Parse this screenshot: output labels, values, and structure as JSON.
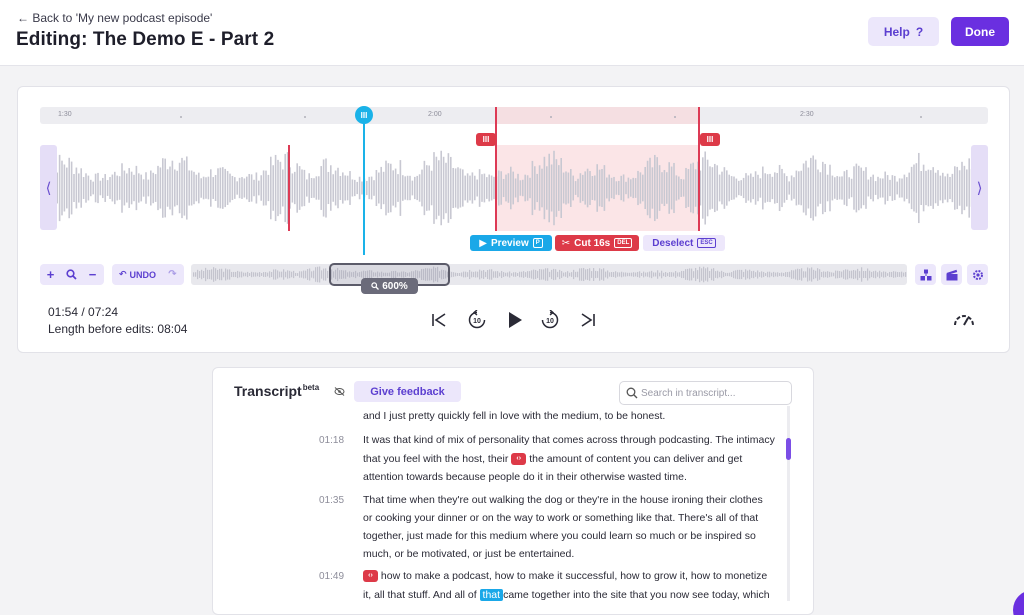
{
  "header": {
    "back_label": "← Back to 'My new podcast episode'",
    "title": "Editing: The Demo E - Part 2",
    "help_label": "Help",
    "help_icon": "?",
    "done_label": "Done"
  },
  "timeline": {
    "ticks": [
      "1:30",
      "2:00",
      "2:30"
    ]
  },
  "selection_actions": {
    "preview_label": "Preview",
    "preview_key": "P",
    "cut_label": "Cut 16s",
    "cut_key": "DEL",
    "deselect_label": "Deselect",
    "deselect_key": "ESC"
  },
  "toolbar": {
    "zoom_in": "+",
    "zoom_out": "−",
    "undo_label": "UNDO",
    "zoom_level": "600%"
  },
  "playback": {
    "current_time": "01:54 / 07:24",
    "length_text": "Length before edits: 08:04",
    "skip_back_seconds": "10",
    "skip_forward_seconds": "10"
  },
  "transcript": {
    "title": "Transcript",
    "beta": "beta",
    "feedback_label": "Give feedback",
    "search_placeholder": "Search in transcript...",
    "top_line": "and I just pretty quickly fell in love with the medium, to be honest.",
    "segments": [
      {
        "time": "01:18",
        "lines": [
          "It was that kind of mix of personality that comes across through podcasting. The intimacy",
          "the amount of content you can deliver and get",
          "attention towards because people do it in their otherwise wasted time."
        ],
        "line2_prefix": "that you feel with the host, their"
      },
      {
        "time": "01:35",
        "lines": [
          "That time when they're out walking the dog or they're in the house ironing their clothes",
          "or cooking your dinner or on the way to work or something like that. There's all of that",
          "together, just made for this medium where you could learn so much or be inspired so",
          "much, or be motivated, or just be entertained."
        ]
      },
      {
        "time": "01:49",
        "line1": "how to make a podcast, how to make it successful, how to grow it, how to monetize",
        "line2_prefix": "it, all that stuff. And all of",
        "highlight_word": "that",
        "line2_suffix": "came together into the site that you now see today, which"
      }
    ]
  },
  "colors": {
    "accent": "#6a2fe0",
    "cut_red": "#dd3a48",
    "playhead_blue": "#1ab2e8",
    "soft_purple": "#ece7fb"
  }
}
